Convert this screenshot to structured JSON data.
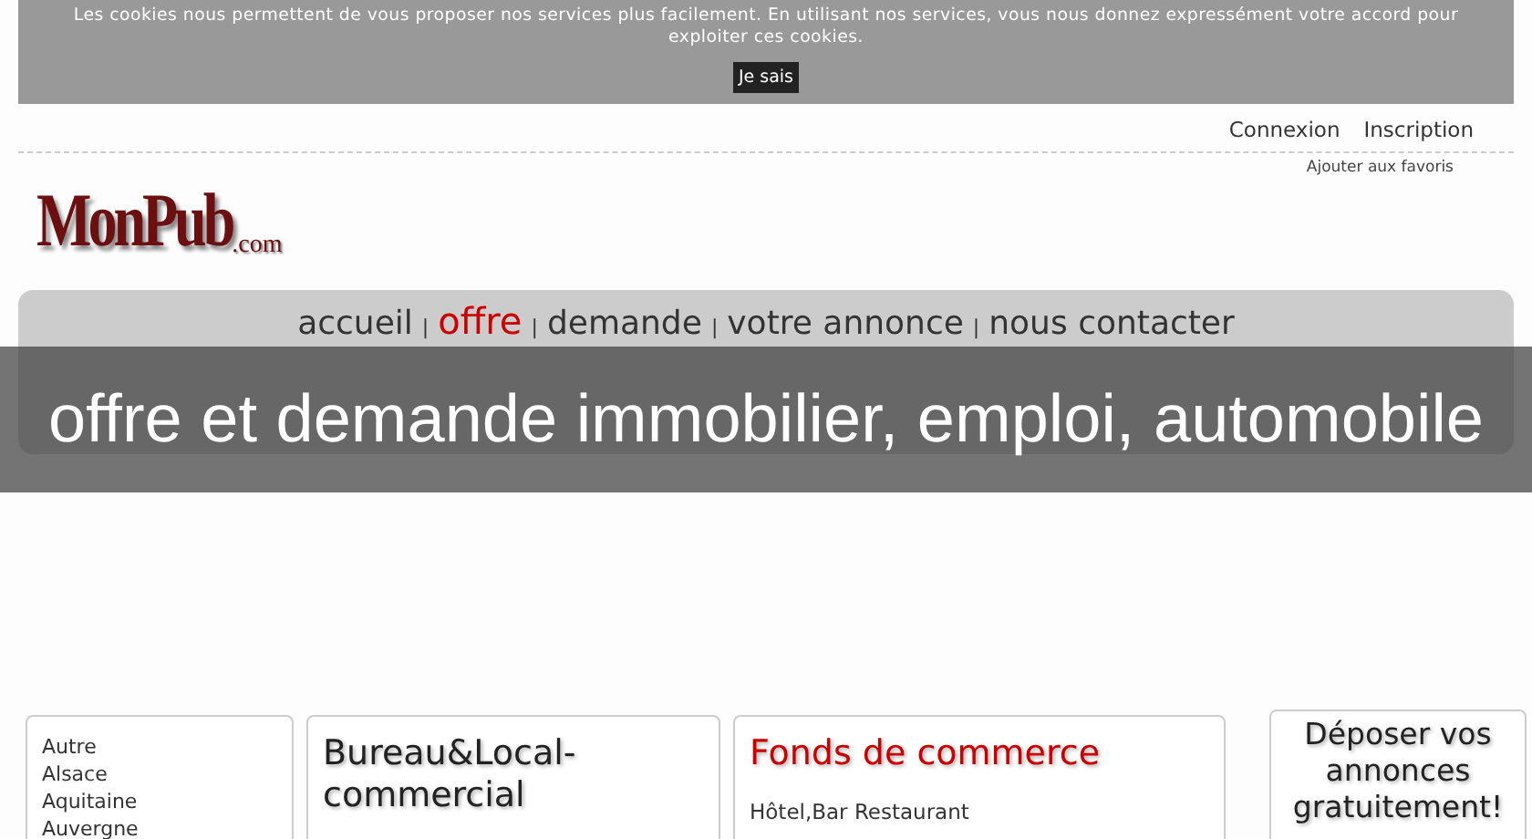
{
  "cookie_bar": {
    "message": "Les cookies nous permettent de vous proposer nos services plus facilement. En utilisant nos services, vous nous donnez expressément votre accord pour exploiter ces cookies.",
    "button": "Je sais"
  },
  "account_links": [
    "Connexion",
    "Inscription"
  ],
  "favorites_link": "Ajouter aux favoris",
  "logo": {
    "main": "MonPub",
    "suffix": ".com"
  },
  "nav": {
    "items": [
      {
        "label": "accueil",
        "selected": false
      },
      {
        "label": "offre",
        "selected": true
      },
      {
        "label": "demande",
        "selected": false
      },
      {
        "label": "votre annonce",
        "selected": false
      },
      {
        "label": "nous contacter",
        "selected": false
      }
    ],
    "separator": "|"
  },
  "caption": "offre et demande immobilier, emploi, automobile",
  "regions": [
    "Autre",
    "Alsace",
    "Aquitaine",
    "Auvergne"
  ],
  "categories": [
    {
      "title": "Bureau&Local-commercial",
      "selected": false
    },
    {
      "title": "Fonds de commerce",
      "selected": true,
      "items": [
        "Hôtel,Bar Restaurant"
      ]
    }
  ],
  "promo": "Déposer vos annonces gratuitement!"
}
